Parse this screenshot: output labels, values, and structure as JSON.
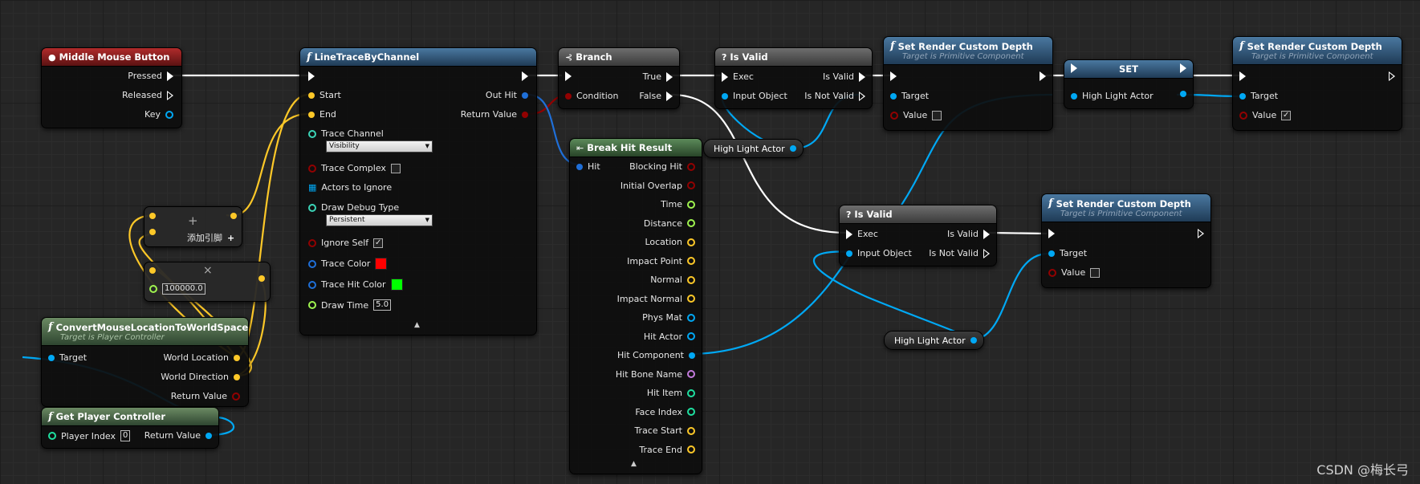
{
  "colors": {
    "exec": "#ffffff",
    "object": "#00a8f4",
    "vector": "#fdc828",
    "bool": "#920101",
    "float": "#9ff44f",
    "name": "#3bd4b7",
    "struct": "#1f6fd8",
    "int": "#1fe0a0",
    "color_red": "#ff0000",
    "color_green": "#00ff00"
  },
  "nodes": {
    "middle_mouse": {
      "title": "Middle Mouse Button",
      "pins": [
        "Pressed",
        "Released",
        "Key"
      ]
    },
    "line_trace": {
      "title": "LineTraceByChannel",
      "start": "Start",
      "end": "End",
      "out_hit": "Out Hit",
      "return_value": "Return Value",
      "trace_channel_label": "Trace Channel",
      "trace_channel_value": "Visibility",
      "trace_complex": "Trace Complex",
      "actors_to_ignore": "Actors to Ignore",
      "draw_debug_label": "Draw Debug Type",
      "draw_debug_value": "Persistent",
      "ignore_self": "Ignore Self",
      "trace_color": "Trace Color",
      "trace_hit_color": "Trace Hit Color",
      "draw_time": "Draw Time",
      "draw_time_value": "5.0"
    },
    "branch": {
      "title": "Branch",
      "true_label": "True",
      "false_label": "False",
      "condition": "Condition"
    },
    "is_valid_1": {
      "title": "Is Valid",
      "exec": "Exec",
      "input": "Input Object",
      "is_valid": "Is Valid",
      "is_not_valid": "Is Not Valid"
    },
    "set_depth_1": {
      "title": "Set Render Custom Depth",
      "subtitle": "Target is Primitive Component",
      "target": "Target",
      "value": "Value"
    },
    "set_var": {
      "title": "SET",
      "var": "High Light Actor"
    },
    "set_depth_2": {
      "title": "Set Render Custom Depth",
      "subtitle": "Target is Primitive Component",
      "target": "Target",
      "value": "Value"
    },
    "break_hit": {
      "title": "Break Hit Result",
      "hit": "Hit",
      "outputs": [
        "Blocking Hit",
        "Initial Overlap",
        "Time",
        "Distance",
        "Location",
        "Impact Point",
        "Normal",
        "Impact Normal",
        "Phys Mat",
        "Hit Actor",
        "Hit Component",
        "Hit Bone Name",
        "Hit Item",
        "Face Index",
        "Trace Start",
        "Trace End"
      ]
    },
    "is_valid_2": {
      "title": "Is Valid",
      "exec": "Exec",
      "input": "Input Object",
      "is_valid": "Is Valid",
      "is_not_valid": "Is Not Valid"
    },
    "set_depth_3": {
      "title": "Set Render Custom Depth",
      "subtitle": "Target is Primitive Component",
      "target": "Target",
      "value": "Value"
    },
    "add_node": {
      "label": "添加引脚"
    },
    "multiply_node": {
      "value": "100000.0"
    },
    "convert_mouse": {
      "title": "ConvertMouseLocationToWorldSpace",
      "subtitle": "Target is Player Controller",
      "target": "Target",
      "world_location": "World Location",
      "world_direction": "World Direction",
      "return_value": "Return Value"
    },
    "get_pc": {
      "title": "Get Player Controller",
      "player_index": "Player Index",
      "player_index_value": "0",
      "return_value": "Return Value"
    }
  },
  "variables": {
    "high_light_actor_1": "High Light Actor",
    "high_light_actor_2": "High Light Actor"
  },
  "watermark": "CSDN @梅长弓"
}
